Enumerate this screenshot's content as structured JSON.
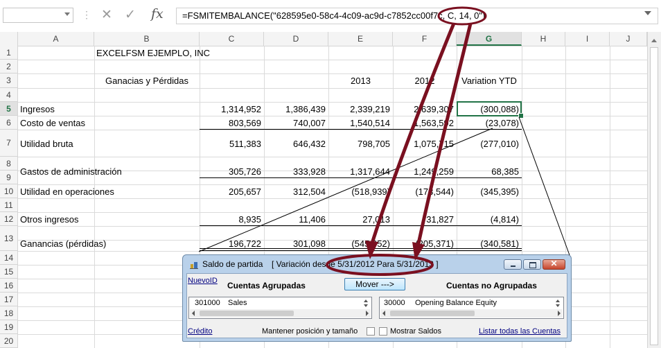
{
  "formula_bar": {
    "name_box": "",
    "cancel_icon": "x-icon",
    "enter_icon": "check-icon",
    "function_icon": "fx",
    "formula": "=FSMITEMBALANCE(\"628595e0-58c4-4c09-ac9d-c7852cc00f7c, C, 14, 0\")"
  },
  "columns": [
    "A",
    "B",
    "C",
    "D",
    "E",
    "F",
    "G",
    "H",
    "I",
    "J"
  ],
  "selected_column": "G",
  "rows": [
    "1",
    "2",
    "3",
    "4",
    "5",
    "6",
    "7",
    "8",
    "9",
    "10",
    "11",
    "12",
    "13",
    "14",
    "15",
    "16",
    "17",
    "18",
    "19",
    "20"
  ],
  "selected_row": "5",
  "cells": {
    "B1": "EXCELFSM EJEMPLO, INC",
    "B3": "Ganacias y Pérdidas",
    "E3": "2013",
    "F3": "2012",
    "G3": "Variation YTD",
    "A5": "Ingresos",
    "C5": "1,314,952",
    "D5": "1,386,439",
    "E5": "2,339,219",
    "F5": "2,639,307",
    "G5": "(300,088)",
    "A6": "Costo de ventas",
    "C6": "803,569",
    "D6": "740,007",
    "E6": "1,540,514",
    "F6": "1,563,592",
    "G6": "(23,078)",
    "A7": "Utilidad bruta",
    "C7": "511,383",
    "D7": "646,432",
    "E7": "798,705",
    "F7": "1,075,715",
    "G7": "(277,010)",
    "A9": "Gastos de administración",
    "C9": "305,726",
    "D9": "333,928",
    "E9": "1,317,644",
    "F9": "1,249,259",
    "G9": "68,385",
    "A10": "Utilidad en operaciones",
    "C10": "205,657",
    "D10": "312,504",
    "E10": "(518,939)",
    "F10": "(173,544)",
    "G10": "(345,395)",
    "A12": "Otros ingresos",
    "C12": "8,935",
    "D12": "11,406",
    "E12": "27,013",
    "F12": "31,827",
    "G12": "(4,814)",
    "A13": "Ganancias (pérdidas)",
    "C13": "196,722",
    "D13": "301,098",
    "E13": "(545,952)",
    "F13": "(205,371)",
    "G13": "(340,581)"
  },
  "dialog": {
    "title": "Saldo de partida",
    "subtitle": "[ Variación desde 5/31/2012 Para 5/31/2013 ]",
    "nuevo_id_link": "NuevoID",
    "grouped_heading": "Cuentas Agrupadas",
    "move_button": "Mover --->",
    "ungrouped_heading": "Cuentas no Agrupadas",
    "left_list": [
      {
        "code": "301000",
        "name": "Sales"
      }
    ],
    "right_list": [
      {
        "code": "30000",
        "name": "Opening Balance Equity"
      }
    ],
    "credit_link": "Crédito",
    "keep_position_label": "Mantener posición y tamaño",
    "show_balances_label": "Mostrar Saldos",
    "list_all_link": "Listar todas las Cuentas",
    "minimize_icon": "minimize-icon",
    "maximize_icon": "maximize-icon",
    "close_icon": "close-icon",
    "close_glyph": "✕"
  },
  "colors": {
    "excel_green": "#217346",
    "annotation": "#7a1020",
    "dialog_frame": "#b9d1ea"
  }
}
